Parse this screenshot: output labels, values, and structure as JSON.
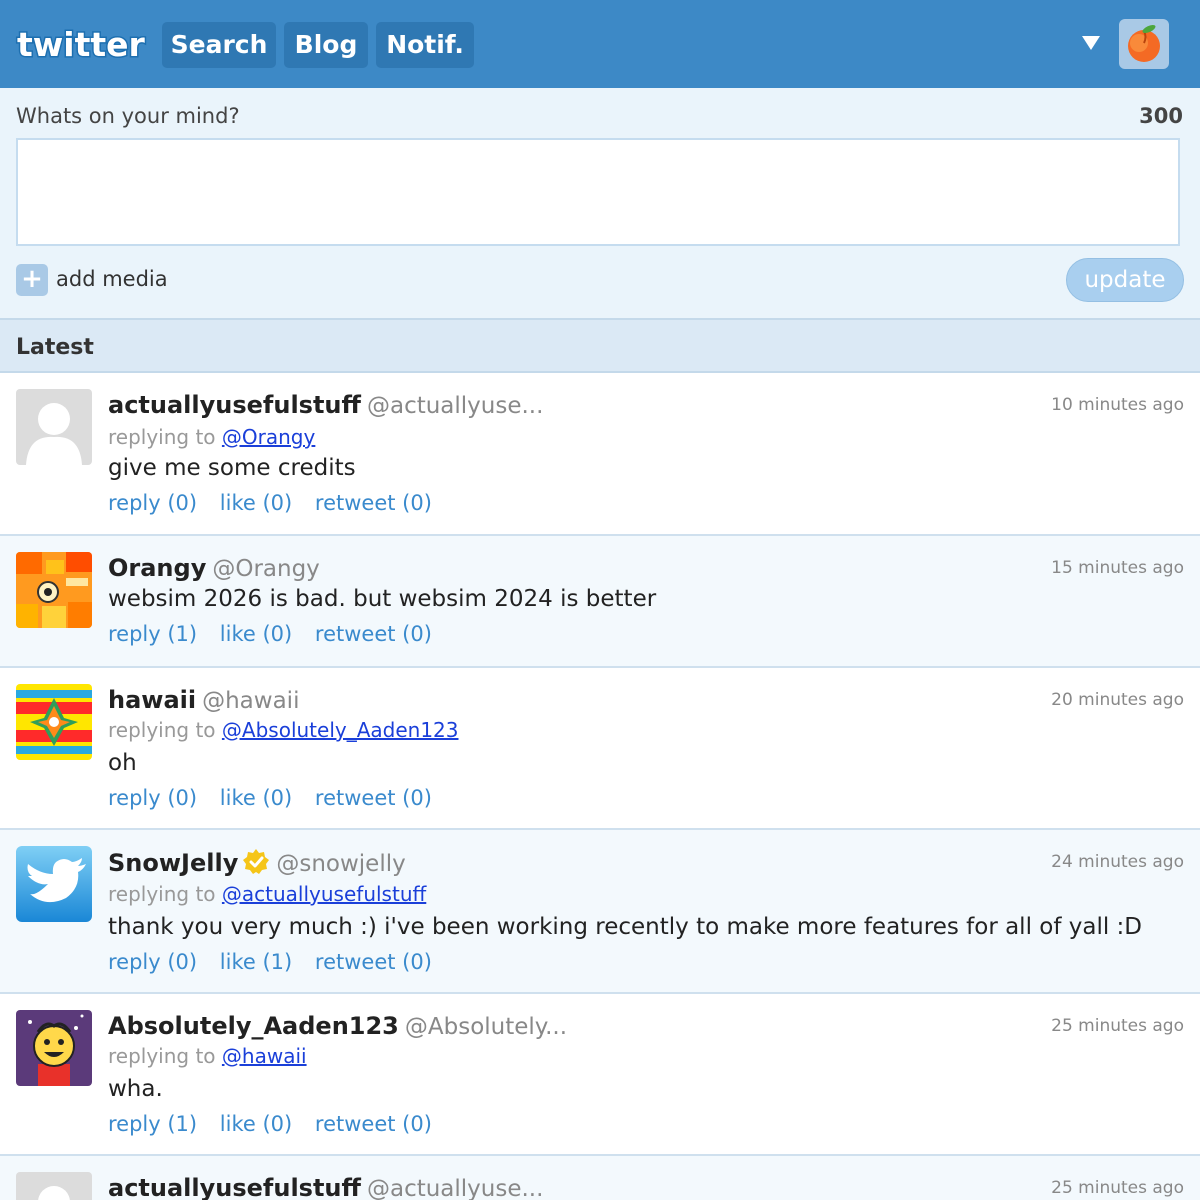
{
  "header": {
    "logo_text": "twitter",
    "nav": [
      "Search",
      "Blog",
      "Notif."
    ],
    "menu_icon": "triangle-down-icon",
    "avatar_icon": "peach-icon"
  },
  "compose": {
    "label": "Whats on your mind?",
    "char_count": "300",
    "input_value": "",
    "add_media_icon": "plus-icon",
    "add_media_symbol": "+",
    "add_media_label": "add media",
    "update_label": "update"
  },
  "feed": {
    "section_label": "Latest",
    "reply_prefix": "replying to",
    "tweets": [
      {
        "name": "actuallyusefulstuff",
        "handle": "@actuallyuse...",
        "time": "10 minutes ago",
        "reply_to": "@Orangy",
        "text": "give me some credits",
        "reply": "reply (0)",
        "like": "like (0)",
        "retweet": "retweet (0)",
        "avatar": "default-person-icon"
      },
      {
        "name": "Orangy",
        "handle": "@Orangy",
        "time": "15 minutes ago",
        "reply_to": "",
        "text": "websim 2026 is bad. but websim 2024 is better",
        "reply": "reply (1)",
        "like": "like (0)",
        "retweet": "retweet (0)",
        "avatar": "orange-pixel-icon"
      },
      {
        "name": "hawaii",
        "handle": "@hawaii",
        "time": "20 minutes ago",
        "reply_to": "@Absolutely_Aaden123",
        "text": "oh",
        "reply": "reply (0)",
        "like": "like (0)",
        "retweet": "retweet (0)",
        "avatar": "hawaii-flag-icon"
      },
      {
        "name": "SnowJelly",
        "handle": "@snowjelly",
        "time": "24 minutes ago",
        "reply_to": "@actuallyusefulstuff",
        "text": "thank you very much :) i've been working recently to make more features for all of yall :D",
        "reply": "reply (0)",
        "like": "like (1)",
        "retweet": "retweet (0)",
        "avatar": "twitter-bird-icon",
        "verified": true
      },
      {
        "name": "Absolutely_Aaden123",
        "handle": "@Absolutely...",
        "time": "25 minutes ago",
        "reply_to": "@hawaii",
        "text": "wha.",
        "reply": "reply (1)",
        "like": "like (0)",
        "retweet": "retweet (0)",
        "avatar": "cartoon-face-icon"
      },
      {
        "name": "actuallyusefulstuff",
        "handle": "@actuallyuse...",
        "time": "25 minutes ago",
        "avatar": "default-person-icon"
      }
    ]
  },
  "colors": {
    "header_bg": "#3d89c6",
    "nav_bg": "#2f78b3",
    "link": "#1a3fd9",
    "action": "#3a8acd",
    "verified": "#f5c518"
  }
}
